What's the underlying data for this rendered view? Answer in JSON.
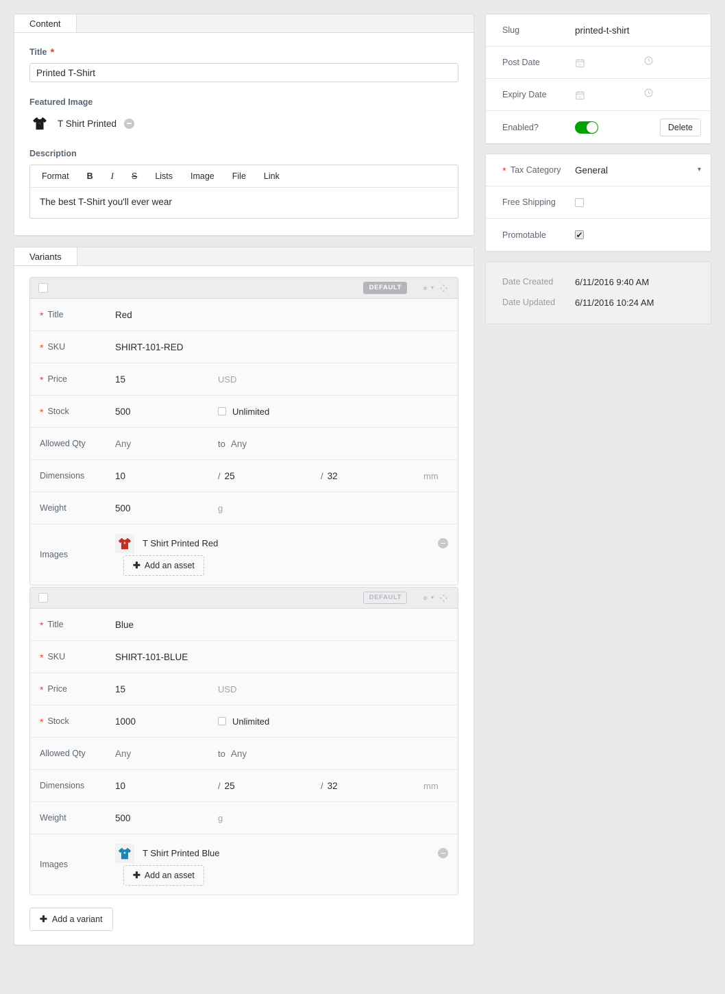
{
  "content_panel": {
    "tabs": [
      {
        "label": "Content",
        "active": true
      }
    ],
    "title_field": {
      "label": "Title",
      "required": true,
      "value": "Printed T-Shirt"
    },
    "featured_image": {
      "label": "Featured Image",
      "asset_name": "T Shirt Printed",
      "thumb_icon": "tshirt-black-icon",
      "remove_icon": "remove-circle-icon"
    },
    "description": {
      "label": "Description",
      "toolbar": [
        "Format",
        "B",
        "I",
        "S",
        "Lists",
        "Image",
        "File",
        "Link"
      ],
      "body": "The best T-Shirt you'll ever wear"
    }
  },
  "variants_panel": {
    "tabs": [
      {
        "label": "Variants",
        "active": true
      }
    ],
    "add_variant_label": "Add a variant",
    "row_labels": {
      "title": "Title",
      "sku": "SKU",
      "price": "Price",
      "stock": "Stock",
      "allowed_qty": "Allowed Qty",
      "dimensions": "Dimensions",
      "weight": "Weight",
      "images": "Images"
    },
    "common": {
      "default_badge": "DEFAULT",
      "currency": "USD",
      "unlimited_label": "Unlimited",
      "qty_placeholder_min": "Any",
      "qty_placeholder_max": "Any",
      "qty_connector": "to",
      "dim_separator": "/",
      "dim_unit": "mm",
      "weight_unit": "g",
      "add_asset_label": "Add an asset",
      "gear_icon": "gear-icon",
      "caret_icon": "chevron-down-icon",
      "move_icon": "move-handle-icon",
      "remove_icon": "remove-circle-icon"
    },
    "variants": [
      {
        "badge_style": "filled",
        "title": "Red",
        "sku": "SHIRT-101-RED",
        "price": "15",
        "stock": "500",
        "unlimited_checked": false,
        "qty_min": "Any",
        "qty_max": "Any",
        "dim_x": "10",
        "dim_y": "25",
        "dim_z": "32",
        "weight": "500",
        "image_name": "T Shirt Printed Red",
        "image_icon": "tshirt-red-icon"
      },
      {
        "badge_style": "outline",
        "title": "Blue",
        "sku": "SHIRT-101-BLUE",
        "price": "15",
        "stock": "1000",
        "unlimited_checked": false,
        "qty_min": "Any",
        "qty_max": "Any",
        "dim_x": "10",
        "dim_y": "25",
        "dim_z": "32",
        "weight": "500",
        "image_name": "T Shirt Printed Blue",
        "image_icon": "tshirt-blue-icon"
      }
    ]
  },
  "sidebar": {
    "slug": {
      "label": "Slug",
      "value": "printed-t-shirt"
    },
    "post_date": {
      "label": "Post Date",
      "date_icon": "calendar-icon",
      "time_icon": "clock-icon"
    },
    "expiry_date": {
      "label": "Expiry Date",
      "date_icon": "calendar-icon",
      "time_icon": "clock-icon"
    },
    "enabled": {
      "label": "Enabled?",
      "on": true,
      "delete_label": "Delete"
    },
    "tax_category": {
      "label": "Tax Category",
      "required": true,
      "value": "General",
      "caret_icon": "chevron-down-icon"
    },
    "free_shipping": {
      "label": "Free Shipping",
      "checked": false
    },
    "promotable": {
      "label": "Promotable",
      "checked": true
    },
    "meta": {
      "date_created_label": "Date Created",
      "date_created_value": "6/11/2016 9:40 AM",
      "date_updated_label": "Date Updated",
      "date_updated_value": "6/11/2016 10:24 AM"
    }
  },
  "colors": {
    "accent_required": "#e5422b",
    "toggle_on": "#00a400",
    "page_bg": "#eaeaec",
    "badge_gray": "#b3b5bb"
  }
}
